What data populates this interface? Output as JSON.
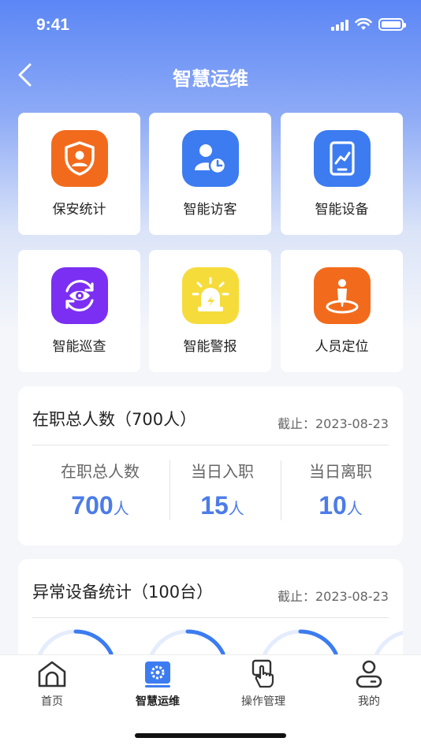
{
  "status": {
    "time": "9:41"
  },
  "nav": {
    "title": "智慧运维"
  },
  "tiles": [
    {
      "label": "保安统计",
      "icon": "security-guard-icon",
      "color": "#f26b1d"
    },
    {
      "label": "智能访客",
      "icon": "visitor-icon",
      "color": "#3c7cf0"
    },
    {
      "label": "智能设备",
      "icon": "device-chart-icon",
      "color": "#3c7cf0"
    },
    {
      "label": "智能巡查",
      "icon": "patrol-eye-icon",
      "color": "#7b2ff2"
    },
    {
      "label": "智能警报",
      "icon": "alarm-light-icon",
      "color": "#f5dc3b"
    },
    {
      "label": "人员定位",
      "icon": "person-location-icon",
      "color": "#f26b1d"
    }
  ],
  "staff_card": {
    "title": "在职总人数（700人）",
    "date": "截止：2023-08-23",
    "stats": [
      {
        "label": "在职总人数",
        "value": "700",
        "unit": "人"
      },
      {
        "label": "当日入职",
        "value": "15",
        "unit": "人"
      },
      {
        "label": "当日离职",
        "value": "10",
        "unit": "人"
      }
    ]
  },
  "device_card": {
    "title": "异常设备统计（100台）",
    "date": "截止：2023-08-23"
  },
  "tabbar": [
    {
      "label": "首页",
      "icon": "home-icon",
      "active": false
    },
    {
      "label": "智慧运维",
      "icon": "maintenance-gear-icon",
      "active": true
    },
    {
      "label": "操作管理",
      "icon": "touch-hand-icon",
      "active": false
    },
    {
      "label": "我的",
      "icon": "profile-icon",
      "active": false
    }
  ],
  "colors": {
    "accent": "#4c7ce8",
    "header_top": "#5b86f5"
  }
}
